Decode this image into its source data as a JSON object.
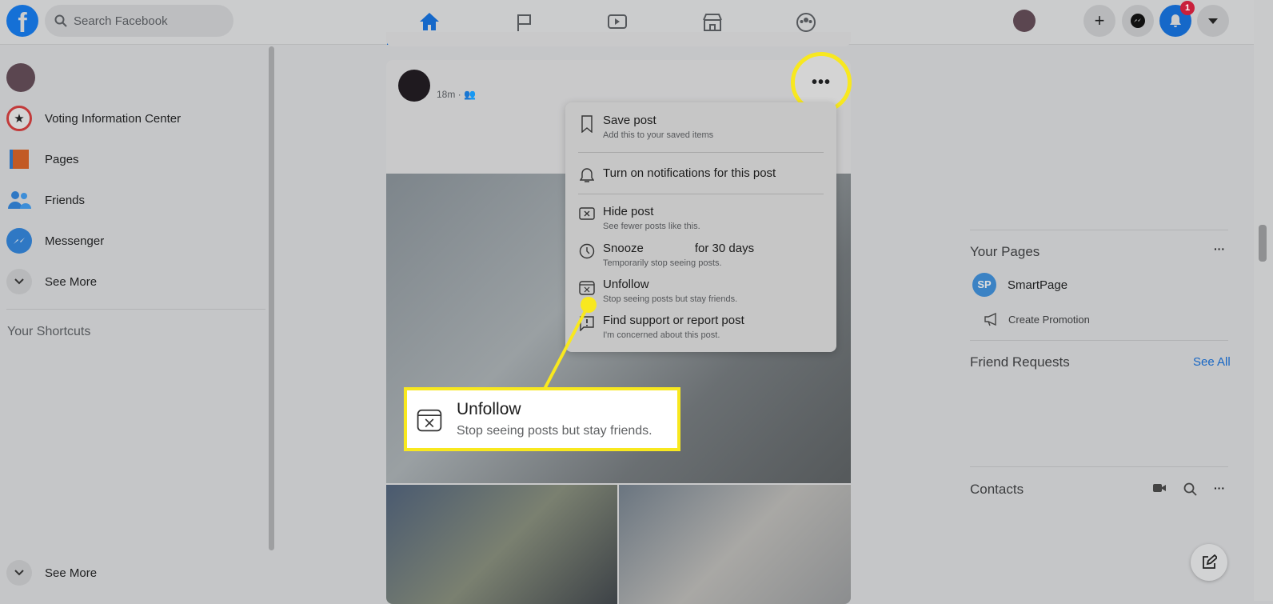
{
  "header": {
    "search_placeholder": "Search Facebook",
    "notification_count": "1",
    "logo": "f"
  },
  "left_sidebar": {
    "items": [
      {
        "label": "Voting Information Center",
        "icon": "voting-icon"
      },
      {
        "label": "Pages",
        "icon": "flag-icon"
      },
      {
        "label": "Friends",
        "icon": "friends-icon"
      },
      {
        "label": "Messenger",
        "icon": "messenger-icon"
      },
      {
        "label": "See More",
        "icon": "chevron-down-icon"
      }
    ],
    "shortcuts_title": "Your Shortcuts",
    "see_more_bottom": "See More"
  },
  "post": {
    "time": "18m"
  },
  "post_menu": {
    "items": [
      {
        "title": "Save post",
        "subtitle": "Add this to your saved items",
        "icon": "bookmark-icon"
      },
      {
        "title": "Turn on notifications for this post",
        "subtitle": "",
        "icon": "bell-icon"
      },
      {
        "title": "Hide post",
        "subtitle": "See fewer posts like this.",
        "icon": "hide-icon"
      },
      {
        "title": "Snooze",
        "title_suffix": "for 30 days",
        "subtitle": "Temporarily stop seeing posts.",
        "icon": "clock-icon"
      },
      {
        "title": "Unfollow",
        "subtitle": "Stop seeing posts but stay friends.",
        "icon": "unfollow-icon"
      },
      {
        "title": "Find support or report post",
        "subtitle": "I'm concerned about this post.",
        "icon": "report-icon"
      }
    ]
  },
  "callout": {
    "title": "Unfollow",
    "subtitle": "Stop seeing posts but stay friends.",
    "highlight_color": "#f8e81f"
  },
  "right_sidebar": {
    "your_pages": "Your Pages",
    "page_name": "SmartPage",
    "page_initials": "SP",
    "create_promotion": "Create Promotion",
    "friend_requests": "Friend Requests",
    "see_all": "See All",
    "contacts": "Contacts"
  }
}
